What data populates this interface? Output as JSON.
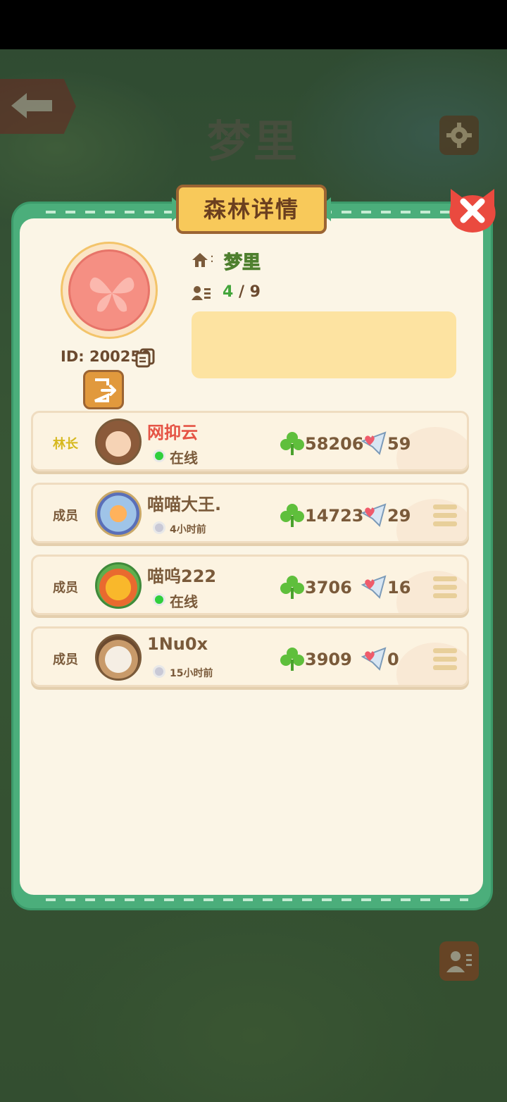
{
  "header": {
    "title": "梦里",
    "back_icon": "back-arrow-icon",
    "settings_icon": "gear-icon"
  },
  "panel": {
    "title": "森林详情",
    "close_icon": "close-icon"
  },
  "forest": {
    "id_text": "ID: 200250",
    "name_separator": ":",
    "name": "梦里",
    "count_separator": ":",
    "member_count": "4",
    "member_capacity": "/ 9",
    "emblem_icon": "butterfly-emblem-icon",
    "description": ""
  },
  "members": [
    {
      "role": "林长",
      "name": "网抑云",
      "status": "在线",
      "online": true,
      "clovers": "58206",
      "gifts": "59",
      "has_menu": false
    },
    {
      "role": "成员",
      "name": "喵喵大王.",
      "status": "4小时前",
      "online": false,
      "clovers": "14723",
      "gifts": "29",
      "has_menu": true
    },
    {
      "role": "成员",
      "name": "喵呜222",
      "status": "在线",
      "online": true,
      "clovers": "3706",
      "gifts": "16",
      "has_menu": true
    },
    {
      "role": "成员",
      "name": "1Nu0x",
      "status": "15小时前",
      "online": false,
      "clovers": "3909",
      "gifts": "0",
      "has_menu": true
    }
  ],
  "colors": {
    "panel_green": "#4bae7b",
    "panel_cream": "#fbf5e6",
    "banner_yellow": "#f8c95a",
    "leader_name": "#e55445",
    "leader_role": "#d6b81e",
    "online_green": "#2fcf3d"
  }
}
